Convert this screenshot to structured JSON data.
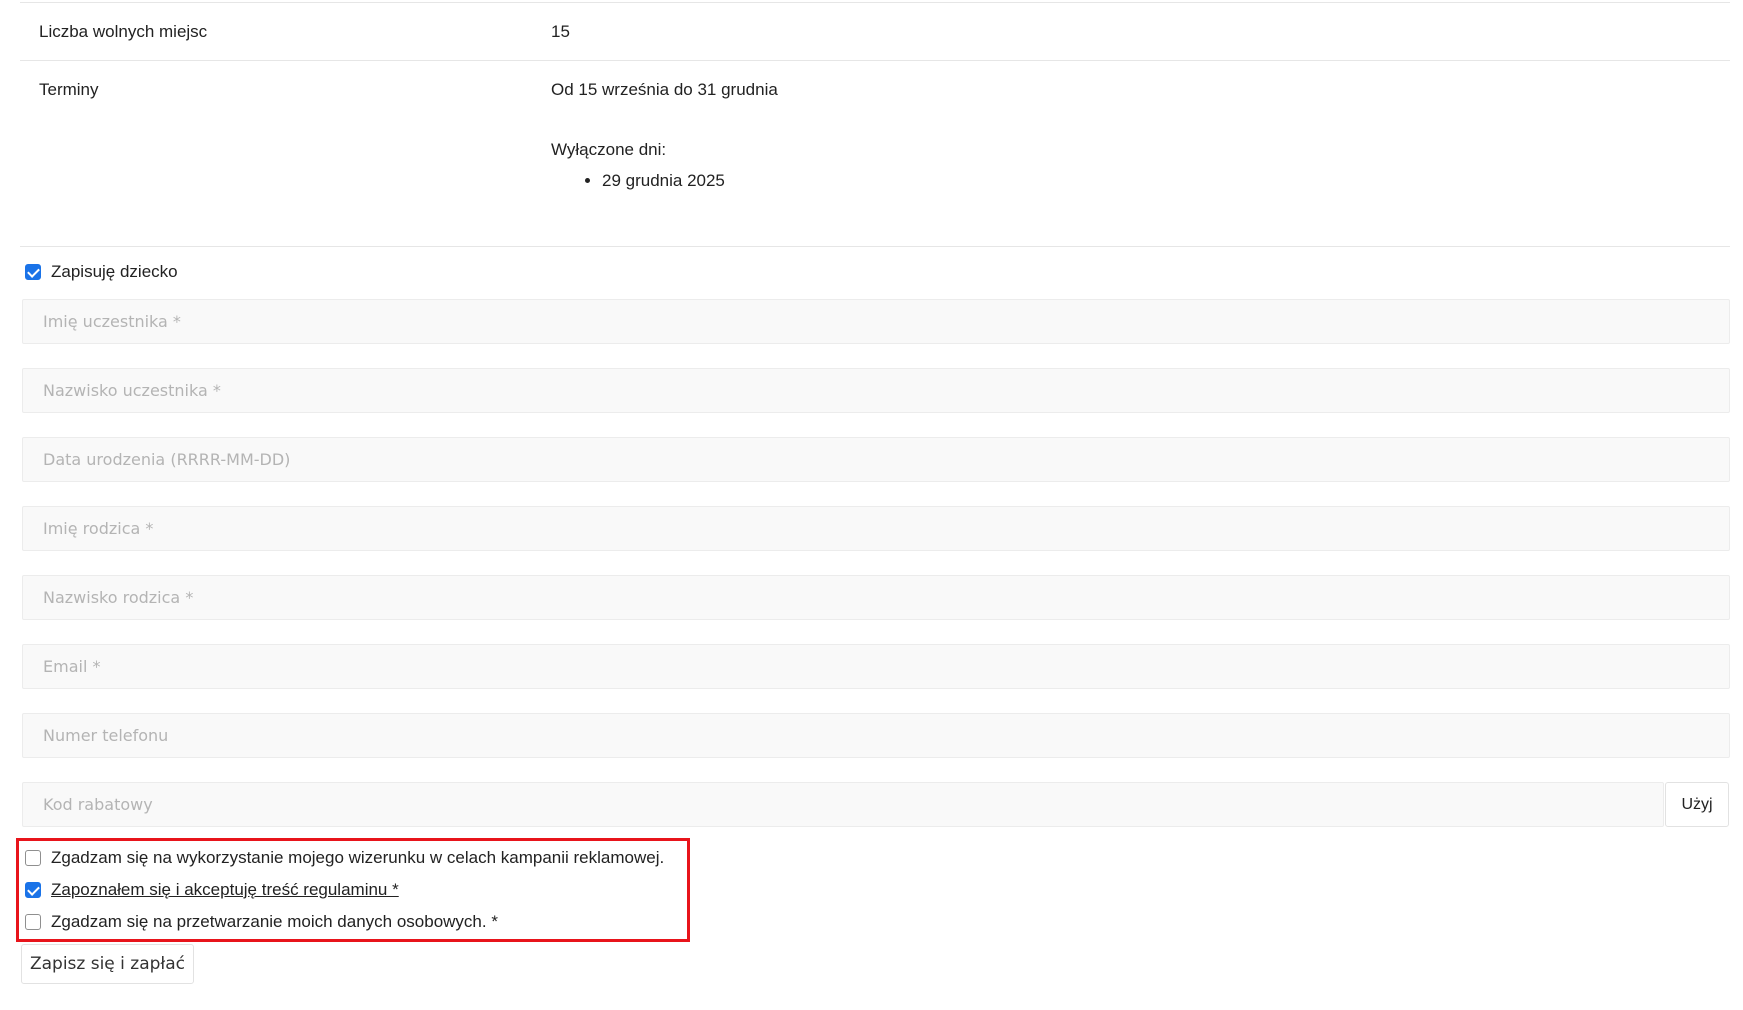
{
  "info": {
    "rows": [
      {
        "label": "Liczba wolnych miejsc",
        "value": "15"
      },
      {
        "label": "Terminy",
        "value": "Od 15 września do 31 grudnia"
      }
    ],
    "excluded_title": "Wyłączone dni:",
    "excluded_days": [
      "29 grudnia 2025"
    ]
  },
  "child_toggle": {
    "label": "Zapisuję dziecko",
    "checked": true
  },
  "form": {
    "fields": [
      {
        "placeholder": "Imię uczestnika *",
        "value": ""
      },
      {
        "placeholder": "Nazwisko uczestnika *",
        "value": ""
      },
      {
        "placeholder": "Data urodzenia (RRRR-MM-DD)",
        "value": ""
      },
      {
        "placeholder": "Imię rodzica *",
        "value": ""
      },
      {
        "placeholder": "Nazwisko rodzica *",
        "value": ""
      },
      {
        "placeholder": "Email *",
        "value": ""
      },
      {
        "placeholder": "Numer telefonu",
        "value": ""
      },
      {
        "placeholder": "Kod rabatowy",
        "value": ""
      }
    ],
    "apply_label": "Użyj"
  },
  "consents": [
    {
      "label": "Zgadzam się na wykorzystanie mojego wizerunku w celach kampanii reklamowej.",
      "checked": false
    },
    {
      "label": "Zapoznałem się i akceptuję treść regulaminu *",
      "checked": true
    },
    {
      "label": "Zgadzam się na przetwarzanie moich danych osobowych. *",
      "checked": false
    }
  ],
  "submit_label": "Zapisz się i zapłać",
  "colors": {
    "checkbox_accent": "#1a73e8",
    "highlight_border": "#e8141b",
    "field_background": "#f9f9f9"
  }
}
